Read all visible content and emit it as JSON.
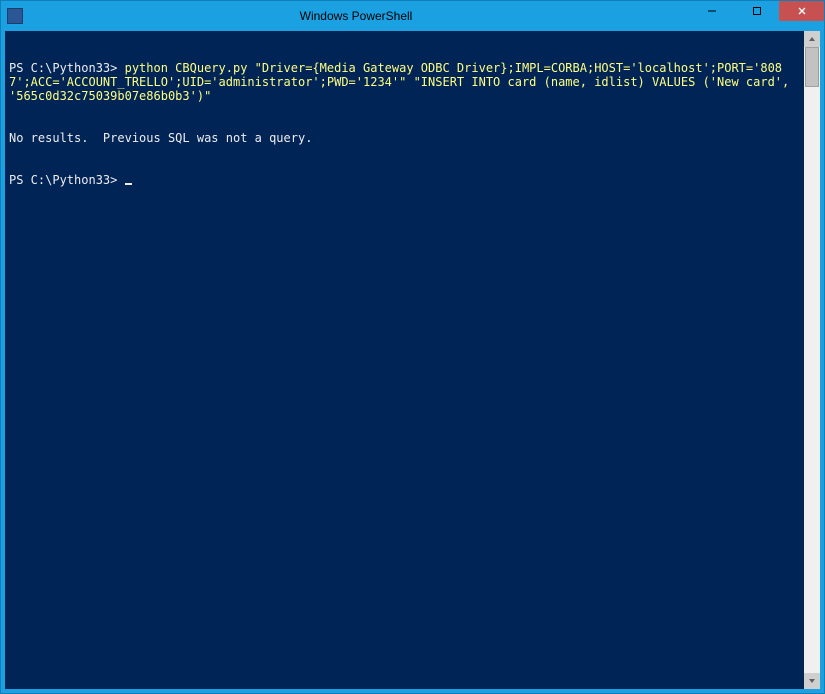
{
  "window": {
    "title": "Windows PowerShell"
  },
  "titlebar": {
    "minimize_label": "–",
    "maximize_label": "",
    "close_label": "✕"
  },
  "console": {
    "prompt1": "PS C:\\Python33> ",
    "command1": "python CBQuery.py \"Driver={Media Gateway ODBC Driver};IMPL=CORBA;HOST='localhost';PORT='8087';ACC='ACCOUNT_TRELLO';UID='administrator';PWD='1234'\" \"INSERT INTO card (name, idlist) VALUES ('New card', '565c0d32c75039b07e86b0b3')\"",
    "output1": "No results.  Previous SQL was not a query.",
    "prompt2": "PS C:\\Python33> "
  }
}
